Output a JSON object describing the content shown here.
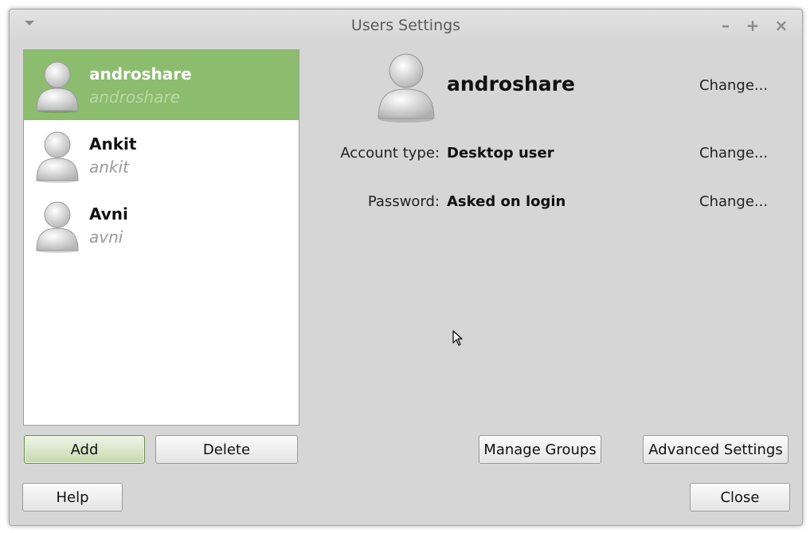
{
  "window": {
    "title": "Users Settings",
    "controls": {
      "minimize": "–",
      "maximize": "+",
      "close": "×"
    }
  },
  "users": [
    {
      "name": "androshare",
      "login": "androshare",
      "selected": true
    },
    {
      "name": "Ankit",
      "login": "ankit",
      "selected": false
    },
    {
      "name": "Avni",
      "login": "avni",
      "selected": false
    }
  ],
  "details": {
    "name": "androshare",
    "name_change": "Change...",
    "account_type_label": "Account type:",
    "account_type_value": "Desktop user",
    "account_type_change": "Change...",
    "password_label": "Password:",
    "password_value": "Asked on login",
    "password_change": "Change..."
  },
  "buttons": {
    "add": "Add",
    "delete": "Delete",
    "manage_groups": "Manage Groups",
    "advanced_settings": "Advanced Settings",
    "help": "Help",
    "close": "Close"
  },
  "colors": {
    "selection": "#8cbc6e",
    "window_bg": "#d6d6d6"
  },
  "icons": {
    "avatar": "user-avatar-icon",
    "window_menu": "window-menu-icon",
    "cursor": "mouse-pointer-icon"
  }
}
